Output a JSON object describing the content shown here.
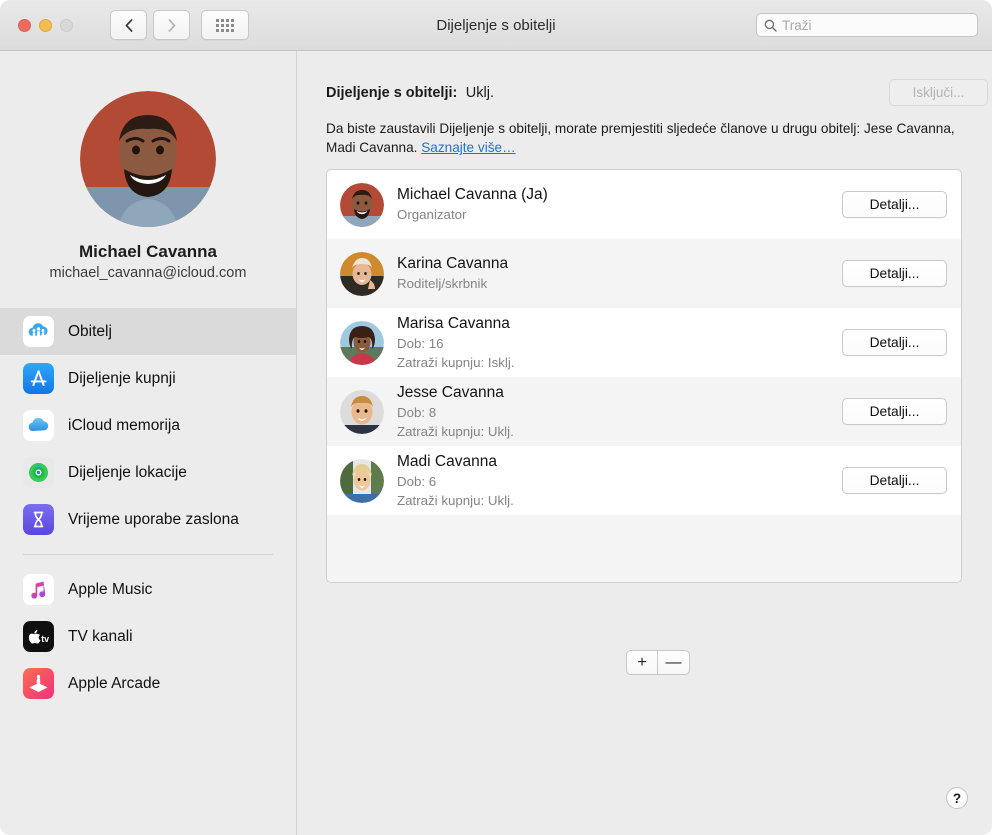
{
  "window": {
    "title": "Dijeljenje s obitelji",
    "traffic_lights": [
      "close",
      "minimize",
      "zoom"
    ],
    "back_label": "back-chevron",
    "forward_label": "forward-chevron",
    "grid_label": "show-all-preferences"
  },
  "search": {
    "placeholder": "Traži",
    "value": "",
    "icon": "search-icon"
  },
  "sidebar": {
    "profile": {
      "name": "Michael Cavanna",
      "email": "michael_cavanna@icloud.com",
      "avatar": "user-photo"
    },
    "items": [
      {
        "label": "Obitelj",
        "icon": "family-cloud-icon",
        "selected": true
      },
      {
        "label": "Dijeljenje kupnji",
        "icon": "app-store-icon",
        "selected": false
      },
      {
        "label": "iCloud memorija",
        "icon": "icloud-icon",
        "selected": false
      },
      {
        "label": "Dijeljenje lokacije",
        "icon": "find-my-icon",
        "selected": false
      },
      {
        "label": "Vrijeme uporabe zaslona",
        "icon": "screen-time-icon",
        "selected": false
      }
    ],
    "items_secondary": [
      {
        "label": "Apple Music",
        "icon": "apple-music-icon"
      },
      {
        "label": "TV kanali",
        "icon": "apple-tv-icon"
      },
      {
        "label": "Apple Arcade",
        "icon": "apple-arcade-icon"
      }
    ]
  },
  "main": {
    "status_label": "Dijeljenje s obitelji:",
    "status_value": "Uklj.",
    "turn_off_button": "Isključi...",
    "turn_off_disabled": true,
    "description": "Da biste zaustavili Dijeljenje s obitelji, morate premjestiti sljedeće članove u drugu obitelj: Jese Cavanna, Madi Cavanna. ",
    "description_link": "Saznajte više…",
    "members": [
      {
        "name": "Michael Cavanna (Ja)",
        "role": "Organizator",
        "age": "",
        "purchase": "",
        "button": "Detalji...",
        "avatar": "member-photo-michael"
      },
      {
        "name": "Karina Cavanna",
        "role": "Roditelj/skrbnik",
        "age": "",
        "purchase": "",
        "button": "Detalji...",
        "avatar": "member-photo-karina"
      },
      {
        "name": "Marisa Cavanna",
        "role": "",
        "age": "Dob: 16",
        "purchase": "Zatraži kupnju: Isklj.",
        "button": "Detalji...",
        "avatar": "member-photo-marisa"
      },
      {
        "name": "Jesse Cavanna",
        "role": "",
        "age": "Dob: 8",
        "purchase": "Zatraži kupnju: Uklj.",
        "button": "Detalji...",
        "avatar": "member-photo-jesse"
      },
      {
        "name": "Madi Cavanna",
        "role": "",
        "age": "Dob: 6",
        "purchase": "Zatraži kupnju: Uklj.",
        "button": "Detalji...",
        "avatar": "member-photo-madi"
      }
    ],
    "add_button": "+",
    "remove_button": "—",
    "help_button": "?"
  },
  "colors": {
    "link": "#1d72d2",
    "sidebar_bg": "#ececec",
    "selected_row": "#dadada",
    "alt_row": "#f4f4f4"
  }
}
